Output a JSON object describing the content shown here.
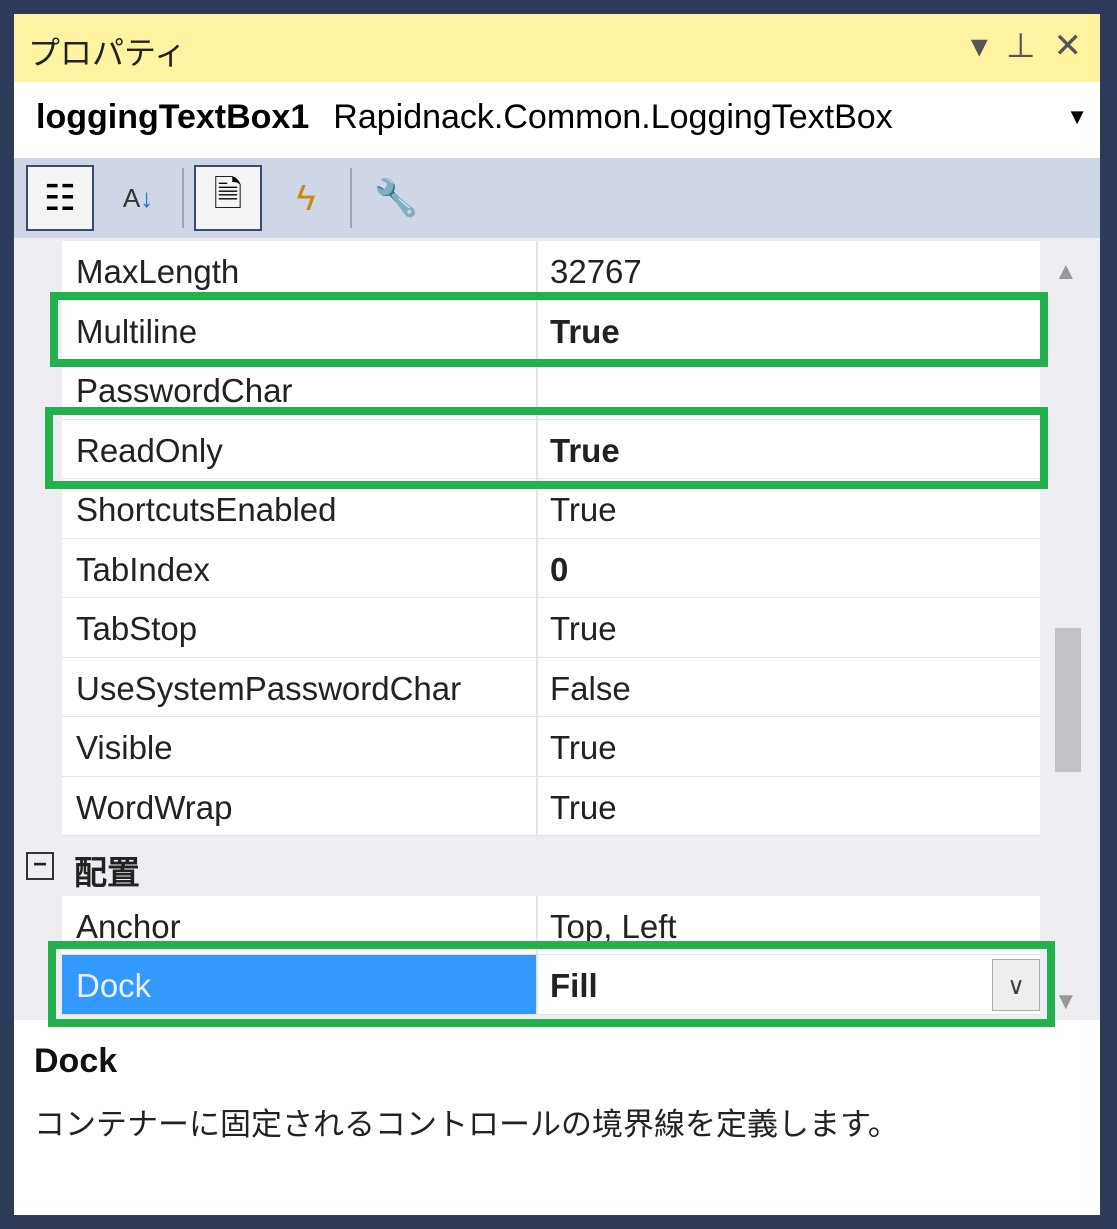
{
  "title": "プロパティ",
  "title_controls": {
    "dropdown": "▾",
    "pin": "⊥",
    "close": "✕"
  },
  "object": {
    "name": "loggingTextBox1",
    "type": "Rapidnack.Common.LoggingTextBox"
  },
  "properties": [
    {
      "name": "MaxLength",
      "value": "32767",
      "bold": false
    },
    {
      "name": "Multiline",
      "value": "True",
      "bold": true
    },
    {
      "name": "PasswordChar",
      "value": "",
      "bold": false
    },
    {
      "name": "ReadOnly",
      "value": "True",
      "bold": true
    },
    {
      "name": "ShortcutsEnabled",
      "value": "True",
      "bold": false
    },
    {
      "name": "TabIndex",
      "value": "0",
      "bold": true
    },
    {
      "name": "TabStop",
      "value": "True",
      "bold": false
    },
    {
      "name": "UseSystemPasswordChar",
      "value": "False",
      "bold": false
    },
    {
      "name": "Visible",
      "value": "True",
      "bold": false
    },
    {
      "name": "WordWrap",
      "value": "True",
      "bold": false
    }
  ],
  "group": {
    "label": "配置",
    "toggle": "−"
  },
  "group_properties": [
    {
      "name": "Anchor",
      "value": "Top, Left",
      "bold": false
    },
    {
      "name": "Dock",
      "value": "Fill",
      "bold": true,
      "selected": true
    }
  ],
  "description": {
    "title": "Dock",
    "text": "コンテナーに固定されるコントロールの境界線を定義します。"
  },
  "colors": {
    "highlight": "#22b14c",
    "selection": "#3399ff",
    "title_bar": "#fdf3a0"
  }
}
